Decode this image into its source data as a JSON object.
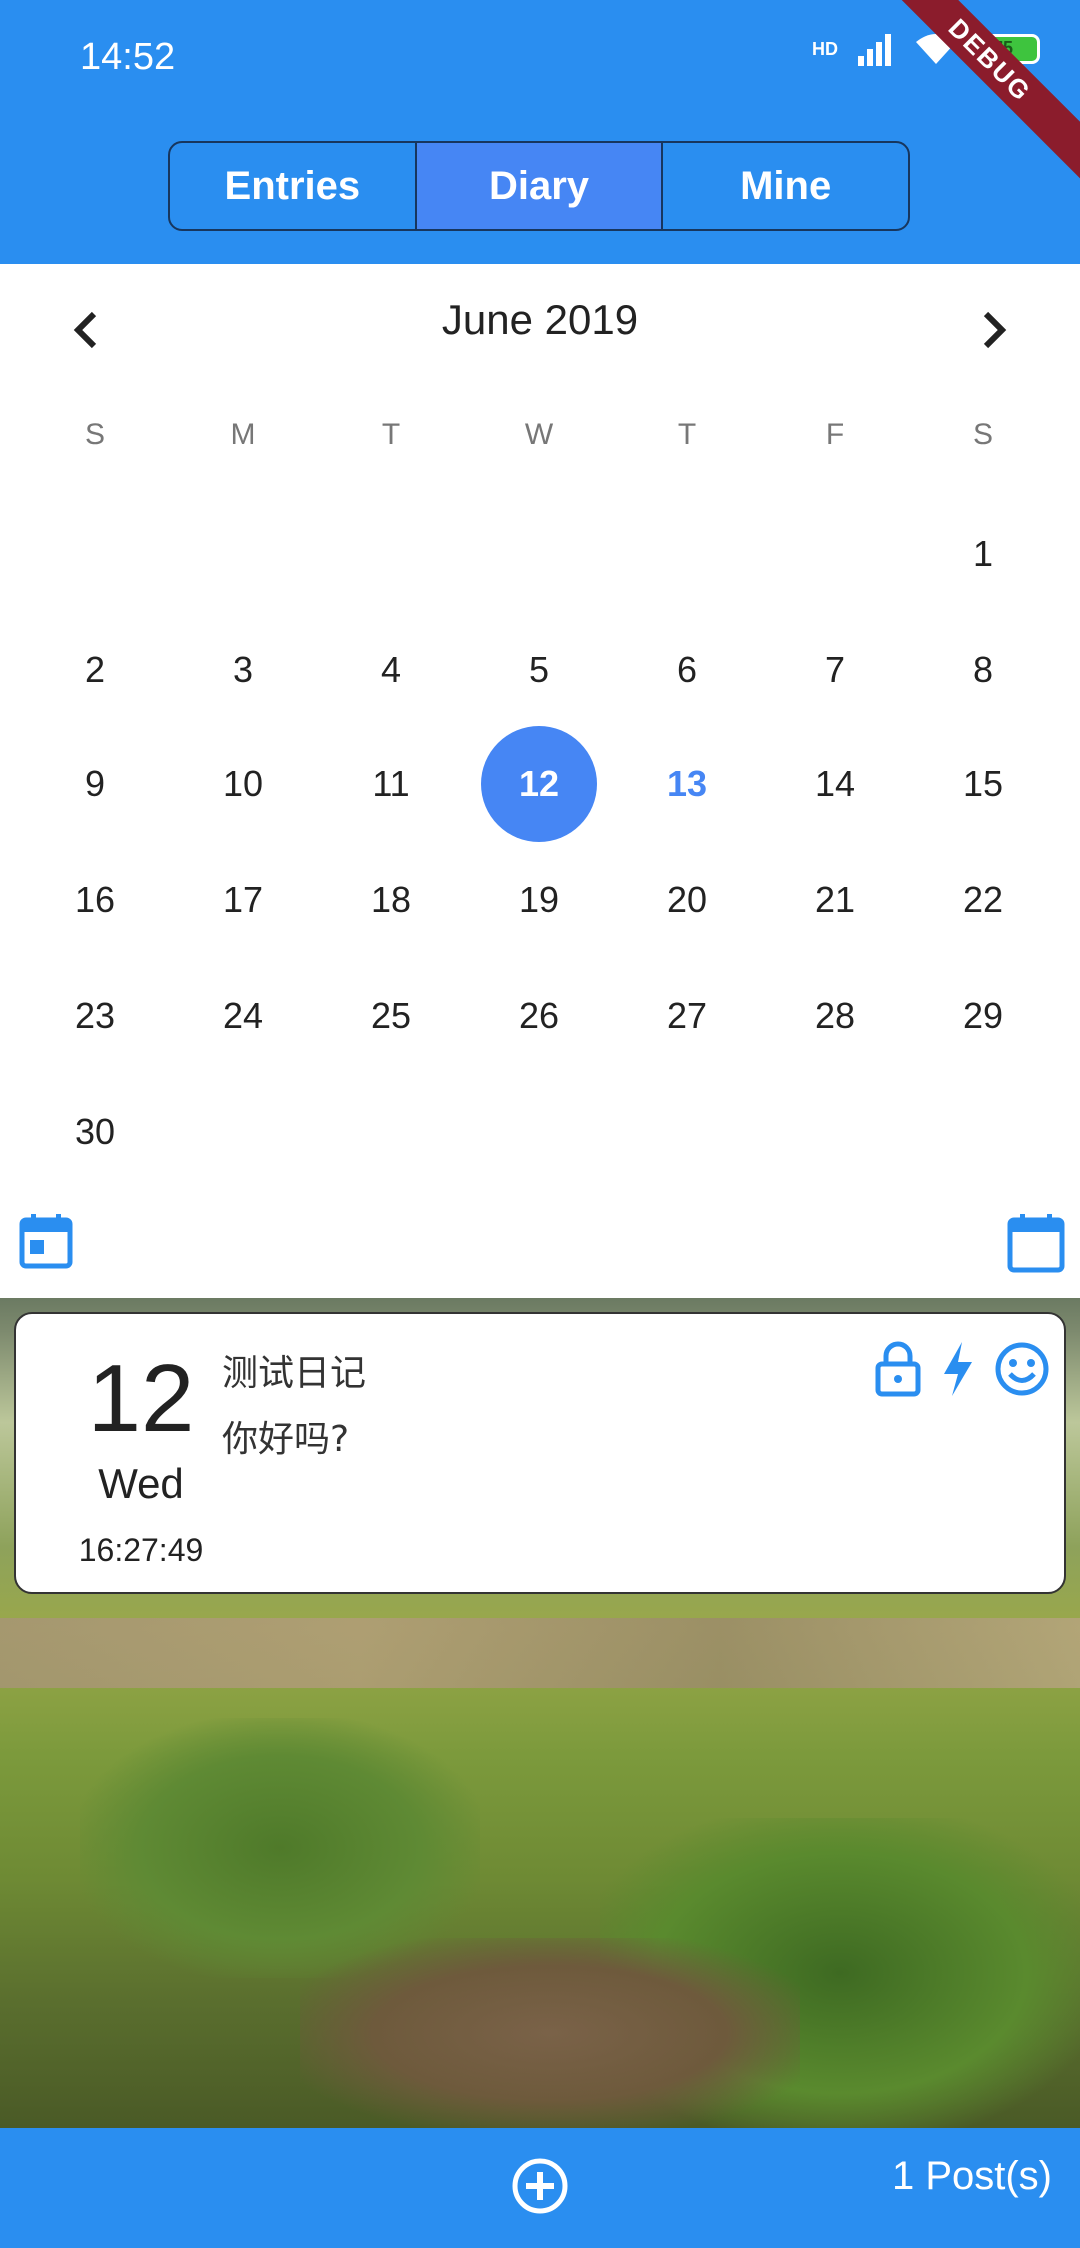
{
  "status": {
    "time": "14:52",
    "battery": "75",
    "network": "HD"
  },
  "debug_label": "DEBUG",
  "tabs": [
    {
      "label": "Entries"
    },
    {
      "label": "Diary"
    },
    {
      "label": "Mine"
    }
  ],
  "active_tab": "Diary",
  "calendar": {
    "month_title": "June 2019",
    "weekdays": [
      "S",
      "M",
      "T",
      "W",
      "T",
      "F",
      "S"
    ],
    "days": [
      "1",
      "2",
      "3",
      "4",
      "5",
      "6",
      "7",
      "8",
      "9",
      "10",
      "11",
      "12",
      "13",
      "14",
      "15",
      "16",
      "17",
      "18",
      "19",
      "20",
      "21",
      "22",
      "23",
      "24",
      "25",
      "26",
      "27",
      "28",
      "29",
      "30"
    ],
    "selected_day": "12",
    "today": "13"
  },
  "entry": {
    "day": "12",
    "weekday": "Wed",
    "time": "16:27:49",
    "title": "测试日记",
    "body": "你好吗?"
  },
  "bottom": {
    "post_count": "1 Post(s)"
  },
  "colors": {
    "primary": "#2a8ef0",
    "accent": "#4686f4"
  }
}
